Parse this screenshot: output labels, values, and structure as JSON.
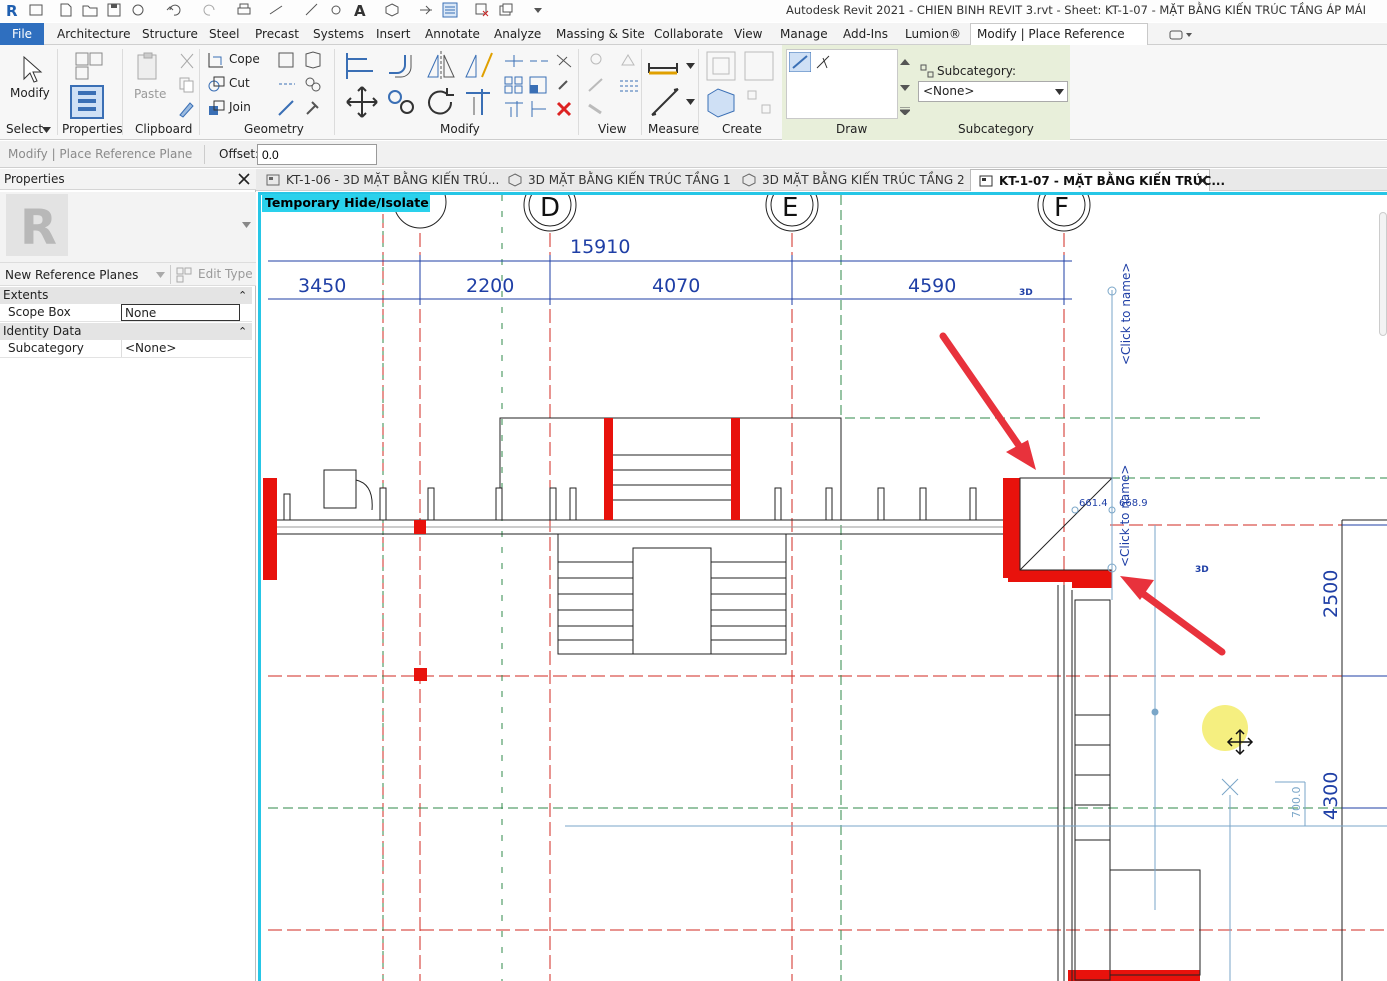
{
  "window": {
    "title": "Autodesk Revit 2021 - CHIEN BINH REVIT 3.rvt - Sheet: KT-1-07 - MẶT BẰNG KIẾN TRÚC TẦNG ÁP MÁI"
  },
  "ribbon_tabs": [
    "File",
    "Architecture",
    "Structure",
    "Steel",
    "Precast",
    "Systems",
    "Insert",
    "Annotate",
    "Analyze",
    "Massing & Site",
    "Collaborate",
    "View",
    "Manage",
    "Add-Ins",
    "Lumion®",
    "Modify | Place Reference Plane"
  ],
  "ribbon": {
    "modify_label": "Modify",
    "select_label": "Select",
    "properties_label": "Properties",
    "paste_label": "Paste",
    "clipboard_label": "Clipboard",
    "cope_label": "Cope",
    "cut_label": "Cut",
    "join_label": "Join",
    "geometry_label": "Geometry",
    "modify_panel_label": "Modify",
    "view_label": "View",
    "measure_label": "Measure",
    "create_label": "Create",
    "draw_label": "Draw",
    "subcategory_field_label": "Subcategory:",
    "subcategory_value": "<None>",
    "subcategory_panel_label": "Subcategory"
  },
  "options_bar": {
    "context": "Modify | Place Reference Plane",
    "offset_label": "Offset:",
    "offset_value": "0.0"
  },
  "properties": {
    "title": "Properties",
    "type_name": "New Reference Planes",
    "edit_type": "Edit Type",
    "groups": [
      {
        "name": "Extents",
        "rows": [
          {
            "key": "Scope Box",
            "value": "None"
          }
        ]
      },
      {
        "name": "Identity Data",
        "rows": [
          {
            "key": "Subcategory",
            "value": "<None>"
          }
        ]
      }
    ]
  },
  "view_tabs": [
    {
      "label": "KT-1-06 - 3D MẶT BẰNG KIẾN TRÚ...",
      "active": false
    },
    {
      "label": "3D MẶT BẰNG KIẾN TRÚC TẦNG 1",
      "active": false
    },
    {
      "label": "3D MẶT BẰNG KIẾN TRÚC TẦNG 2",
      "active": false
    },
    {
      "label": "KT-1-07 - MẶT BẰNG KIẾN TRÚC...",
      "active": true
    }
  ],
  "canvas": {
    "temp_hide_label": "Temporary Hide/Isolate",
    "grid_labels": [
      "D",
      "E",
      "F"
    ],
    "total_dim": "15910",
    "segment_dims": [
      "3450",
      "2200",
      "4070",
      "4590"
    ],
    "label_3d": "3D",
    "click_to_name": "<Click to name>",
    "temp_dim_1": "661.4",
    "temp_dim_2": "668.9",
    "right_dim_1": "2500",
    "right_dim_2": "4300",
    "small_dim": "700.0"
  },
  "colors": {
    "file_tab": "#2f6fbf",
    "temp_hide_bg": "#2ad1ec",
    "wall_red": "#e8120c",
    "dim_blue": "#1f3fa6",
    "arrow_red": "#e8323c"
  }
}
